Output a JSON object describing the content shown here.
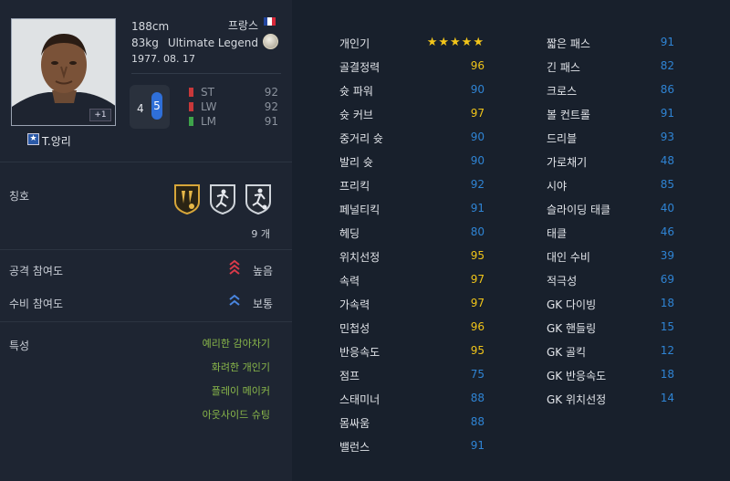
{
  "player": {
    "name": "T.앙리",
    "height": "188cm",
    "weight": "83kg",
    "birth": "1977. 08. 17",
    "nation": "프랑스",
    "season": "Ultimate Legend",
    "plus_badge": "+1",
    "name_icon": "★"
  },
  "feet": {
    "left": "4",
    "right": "5"
  },
  "positions": [
    {
      "pos": "ST",
      "value": "92",
      "color": "#c8383a"
    },
    {
      "pos": "LW",
      "value": "92",
      "color": "#c8383a"
    },
    {
      "pos": "LM",
      "value": "91",
      "color": "#3ea34a"
    }
  ],
  "title_section": {
    "label": "칭호",
    "count": "9 개"
  },
  "attack_work": {
    "label": "공격 참여도",
    "value": "높음"
  },
  "defense_work": {
    "label": "수비 참여도",
    "value": "보통"
  },
  "traits": {
    "label": "특성",
    "items": [
      "예리한 감아차기",
      "화려한 개인기",
      "플레이 메이커",
      "아웃사이드 슈팅"
    ]
  },
  "stats_col1": [
    {
      "name": "개인기",
      "value": "★★★★★",
      "stars": true
    },
    {
      "name": "골결정력",
      "value": "96",
      "hi": true
    },
    {
      "name": "슛 파워",
      "value": "90"
    },
    {
      "name": "슛 커브",
      "value": "97",
      "hi": true
    },
    {
      "name": "중거리 슛",
      "value": "90"
    },
    {
      "name": "발리 슛",
      "value": "90"
    },
    {
      "name": "프리킥",
      "value": "92"
    },
    {
      "name": "페널티킥",
      "value": "91"
    },
    {
      "name": "헤딩",
      "value": "80"
    },
    {
      "name": "위치선정",
      "value": "95",
      "hi": true
    },
    {
      "name": "속력",
      "value": "97",
      "hi": true
    },
    {
      "name": "가속력",
      "value": "97",
      "hi": true
    },
    {
      "name": "민첩성",
      "value": "96",
      "hi": true
    },
    {
      "name": "반응속도",
      "value": "95",
      "hi": true
    },
    {
      "name": "점프",
      "value": "75"
    },
    {
      "name": "스태미너",
      "value": "88"
    },
    {
      "name": "몸싸움",
      "value": "88"
    },
    {
      "name": "밸런스",
      "value": "91"
    }
  ],
  "stats_col2": [
    {
      "name": "짧은 패스",
      "value": "91"
    },
    {
      "name": "긴 패스",
      "value": "82"
    },
    {
      "name": "크로스",
      "value": "86"
    },
    {
      "name": "볼 컨트롤",
      "value": "91"
    },
    {
      "name": "드리블",
      "value": "93"
    },
    {
      "name": "가로채기",
      "value": "48"
    },
    {
      "name": "시야",
      "value": "85"
    },
    {
      "name": "슬라이딩 태클",
      "value": "40"
    },
    {
      "name": "태클",
      "value": "46"
    },
    {
      "name": "대인 수비",
      "value": "39"
    },
    {
      "name": "적극성",
      "value": "69"
    },
    {
      "name": "GK 다이빙",
      "value": "18"
    },
    {
      "name": "GK 핸들링",
      "value": "15"
    },
    {
      "name": "GK 골킥",
      "value": "12"
    },
    {
      "name": "GK 반응속도",
      "value": "18"
    },
    {
      "name": "GK 위치선정",
      "value": "14"
    }
  ],
  "colors": {
    "highlight": "#f0c419",
    "normal_stat": "#2f84d4",
    "trait": "#8ab84a",
    "attack_arrow": "#d93a4a",
    "defense_arrow": "#4a86e0"
  },
  "icons": {
    "flag": "france-flag-icon",
    "season": "legend-medal-icon",
    "emblems": [
      "joker-shield-icon",
      "runner-shield-icon",
      "dribbler-shield-icon"
    ],
    "attack": "triple-arrow-up-icon",
    "defense": "double-arrow-up-icon"
  }
}
